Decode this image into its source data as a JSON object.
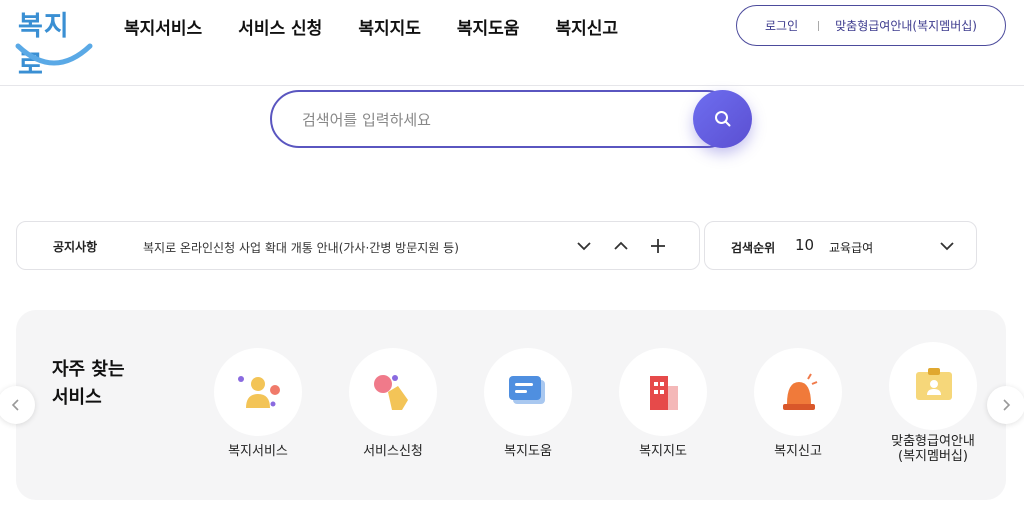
{
  "header": {
    "logo_text": "복지로",
    "nav": [
      "복지서비스",
      "서비스 신청",
      "복지지도",
      "복지도움",
      "복지신고"
    ],
    "login_label": "로그인",
    "membership_label": "맞춤형급여안내(복지멤버십)"
  },
  "search": {
    "placeholder": "검색어를 입력하세요",
    "value": ""
  },
  "notice": {
    "title": "공지사항",
    "text": "복지로 온라인신청 사업 확대 개통 안내(가사·간병 방문지원 등)"
  },
  "ranking": {
    "title": "검색순위",
    "rank": "10",
    "keyword": "교육급여"
  },
  "quick": {
    "title_line1": "자주 찾는",
    "title_line2": "서비스",
    "items": [
      {
        "label": "복지서비스",
        "icon": "person-bubbles-icon"
      },
      {
        "label": "서비스신청",
        "icon": "hand-click-icon"
      },
      {
        "label": "복지도움",
        "icon": "chat-card-icon"
      },
      {
        "label": "복지지도",
        "icon": "building-icon"
      },
      {
        "label": "복지신고",
        "icon": "siren-icon"
      },
      {
        "label_line1": "맞춤형급여안내",
        "label_line2": "(복지멤버십)",
        "icon": "id-card-icon"
      }
    ]
  },
  "colors": {
    "brand": "#3a8fd3",
    "accent": "#5b4fd1",
    "panel": "#f5f5f6"
  }
}
